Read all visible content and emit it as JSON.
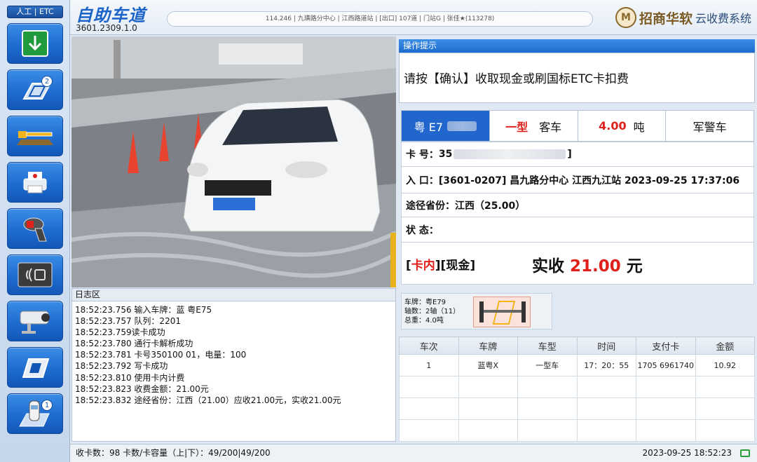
{
  "sidebar": {
    "mode_switch": "人工 | ETC",
    "buttons": [
      {
        "name": "raise-barrier",
        "icon": "arrow-down-icon"
      },
      {
        "name": "lane-queue",
        "icon": "lane-icon",
        "badge": "2"
      },
      {
        "name": "barrier-control",
        "icon": "barrier-icon"
      },
      {
        "name": "print-receipt",
        "icon": "printer-icon"
      },
      {
        "name": "scanner",
        "icon": "barcode-scanner-icon"
      },
      {
        "name": "card-reader",
        "icon": "card-reader-icon"
      },
      {
        "name": "camera",
        "icon": "camera-icon"
      },
      {
        "name": "card-slot",
        "icon": "card-icon"
      },
      {
        "name": "vehicle-lane",
        "icon": "car-lane-icon",
        "badge": "1"
      }
    ]
  },
  "header": {
    "title": "自助车道",
    "version": "3601.2309.1.0",
    "station_info": "114.246 | 九璜路分中心 | 江西路道站 | [出口] 107道 | 门站G                                    | 张佳★(113278)",
    "brand_logo": "M",
    "brand_name": "招商华软",
    "brand_sub": "云收费系统"
  },
  "log": {
    "title": "日志区",
    "lines": [
      "18:52:23.756 输入车牌：蓝 粤E75",
      "18:52:23.757 队列：2201",
      "18:52:23.759读卡成功",
      "18:52:23.780 通行卡解析成功",
      "18:52:23.781 卡号350100                 01，电量：100",
      "18:52:23.792 写卡成功",
      "18:52:23.810 使用卡内计费",
      "18:52:23.823 收费金额：21.00元",
      "18:52:23.832 途经省份：江西（21.00）应收21.00元，实收21.00元"
    ]
  },
  "tips": {
    "title": "操作提示",
    "message": "请按【确认】收取现金或刷国标ETC卡扣费"
  },
  "vehicle": {
    "plate": "粤  E7",
    "class_red": "一型",
    "class_type": "客车",
    "weight_value": "4.00",
    "weight_unit": "吨",
    "special": "军警车"
  },
  "card": {
    "card_label": "卡 号：",
    "card_no_prefix": "35",
    "card_no_suffix": "]",
    "entry_label": "入 口：",
    "entry_value": "[3601-0207] 昌九路分中心 江西九江站 2023-09-25 17:37:06",
    "provinces_label": "途径省份：",
    "provinces_value": "江西（25.00）",
    "status_label": "状 态："
  },
  "payment": {
    "bracket_open": "[",
    "card_type": "卡内",
    "type_rest": "][现金]",
    "amount_label": "实收 ",
    "amount_value": "21.00",
    "amount_unit": " 元"
  },
  "axle": {
    "plate_line": "车牌：粤E79",
    "axle_line": "轴数：2轴（11）",
    "weight_line": "总重：4.0吨"
  },
  "transactions": {
    "headers": [
      "车次",
      "车牌",
      "车型",
      "时间",
      "支付卡",
      "金额"
    ],
    "rows": [
      [
        "1",
        "蓝粤X",
        "一型车",
        "17：20：55",
        "1705          6961740",
        "10.92"
      ]
    ]
  },
  "footer": {
    "left": "收卡数：98   卡数/卡容量（上|下）：49/200|49/200",
    "datetime": "2023-09-25 18:52:23"
  },
  "colors": {
    "accent_blue": "#1f6cd0",
    "alert_red": "#e0201a"
  }
}
